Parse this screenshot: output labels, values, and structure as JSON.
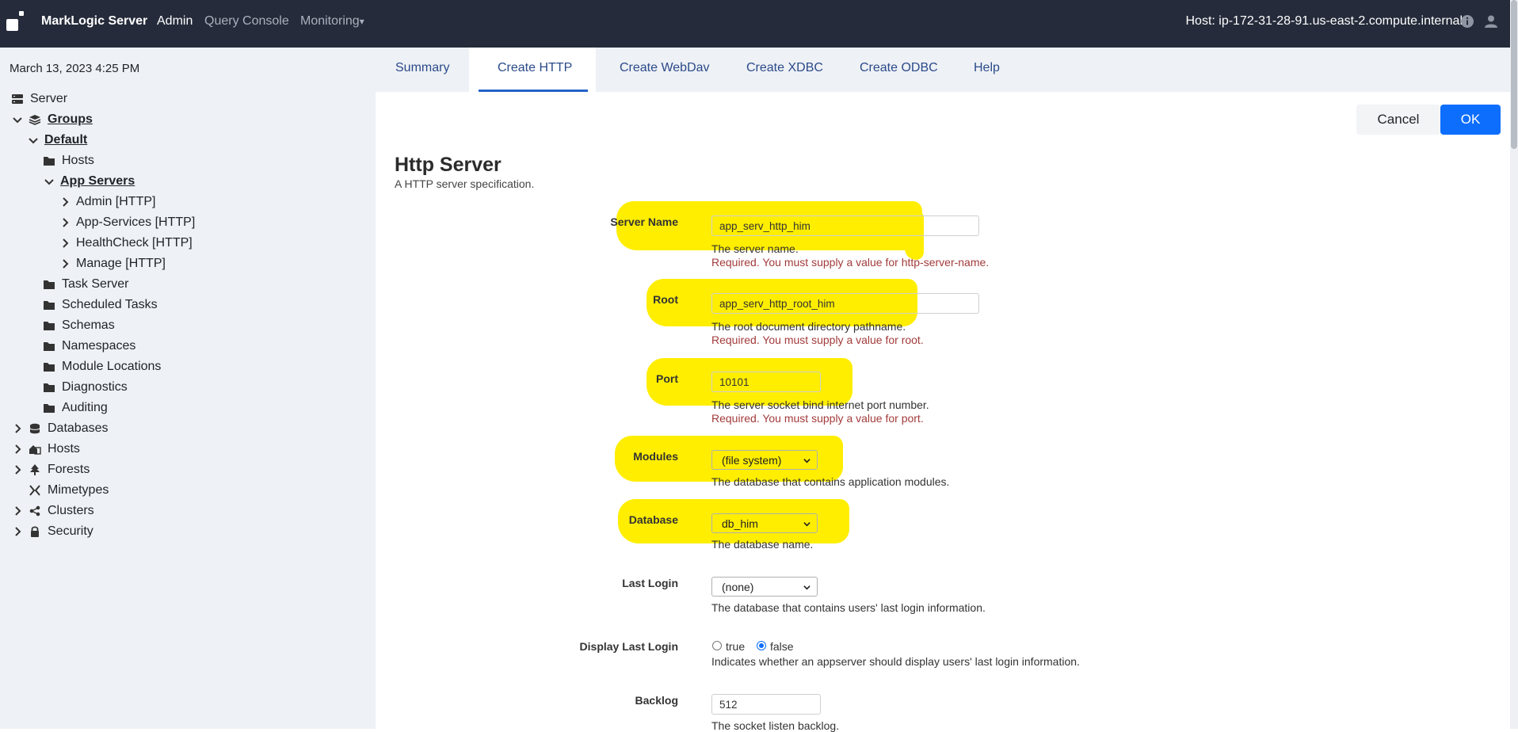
{
  "topbar": {
    "brand": "MarkLogic Server",
    "nav": [
      "Admin",
      "Query Console",
      "Monitoring"
    ],
    "monitoring_caret": "▾",
    "host": "Host: ip-172-31-28-91.us-east-2.compute.internal",
    "icons": [
      "info-icon",
      "user-icon"
    ]
  },
  "sidebar": {
    "datetime": "March 13, 2023 4:25 PM",
    "tree": [
      {
        "label": "Server",
        "icon": "server-icon"
      },
      {
        "label": "Groups",
        "icon": "layers-icon",
        "expanded": true
      },
      {
        "label": "Default",
        "expanded": true
      },
      {
        "label": "Hosts",
        "icon": "folder-icon"
      },
      {
        "label": "App Servers",
        "expanded": true
      },
      {
        "label": "Admin [HTTP]",
        "collapsed": true
      },
      {
        "label": "App-Services [HTTP]",
        "collapsed": true
      },
      {
        "label": "HealthCheck [HTTP]",
        "collapsed": true
      },
      {
        "label": "Manage [HTTP]",
        "collapsed": true
      },
      {
        "label": "Task Server",
        "icon": "folder-icon"
      },
      {
        "label": "Scheduled Tasks",
        "icon": "folder-icon"
      },
      {
        "label": "Schemas",
        "icon": "folder-icon"
      },
      {
        "label": "Namespaces",
        "icon": "folder-icon"
      },
      {
        "label": "Module Locations",
        "icon": "folder-icon"
      },
      {
        "label": "Diagnostics",
        "icon": "folder-icon"
      },
      {
        "label": "Auditing",
        "icon": "folder-icon"
      },
      {
        "label": "Databases",
        "icon": "database-icon",
        "collapsed": true
      },
      {
        "label": "Hosts",
        "icon": "hosts-icon",
        "collapsed": true
      },
      {
        "label": "Forests",
        "icon": "tree-icon",
        "collapsed": true
      },
      {
        "label": "Mimetypes",
        "icon": "mimetype-icon"
      },
      {
        "label": "Clusters",
        "icon": "share-icon",
        "collapsed": true
      },
      {
        "label": "Security",
        "icon": "lock-icon",
        "collapsed": true
      }
    ]
  },
  "tabs": [
    "Summary",
    "Create HTTP",
    "Create WebDav",
    "Create XDBC",
    "Create ODBC",
    "Help"
  ],
  "active_tab": "Create HTTP",
  "actions": {
    "cancel": "Cancel",
    "ok": "OK"
  },
  "form": {
    "title": "Http Server",
    "subtitle": "A HTTP server specification.",
    "server_name": {
      "label": "Server Name",
      "value": "app_serv_http_him",
      "desc": "The server name.",
      "error": "Required. You must supply a value for http-server-name."
    },
    "root": {
      "label": "Root",
      "value": "app_serv_http_root_him",
      "desc": "The root document directory pathname.",
      "error": "Required. You must supply a value for root."
    },
    "port": {
      "label": "Port",
      "value": "10101",
      "desc": "The server socket bind internet port number.",
      "error": "Required. You must supply a value for port."
    },
    "modules": {
      "label": "Modules",
      "value": "(file system)",
      "desc": "The database that contains application modules."
    },
    "database": {
      "label": "Database",
      "value": "db_him",
      "desc": "The database name."
    },
    "last_login": {
      "label": "Last Login",
      "value": "(none)",
      "desc": "The database that contains users' last login information."
    },
    "display_last_login": {
      "label": "Display Last Login",
      "options": [
        "true",
        "false"
      ],
      "selected": "false",
      "desc": "Indicates whether an appserver should display users' last login information."
    },
    "backlog": {
      "label": "Backlog",
      "value": "512",
      "desc": "The socket listen backlog."
    }
  },
  "colors": {
    "topbar": "#252b3a",
    "highlight": "#ffee00",
    "accent": "#0d6efd",
    "error": "#a33b3b"
  }
}
